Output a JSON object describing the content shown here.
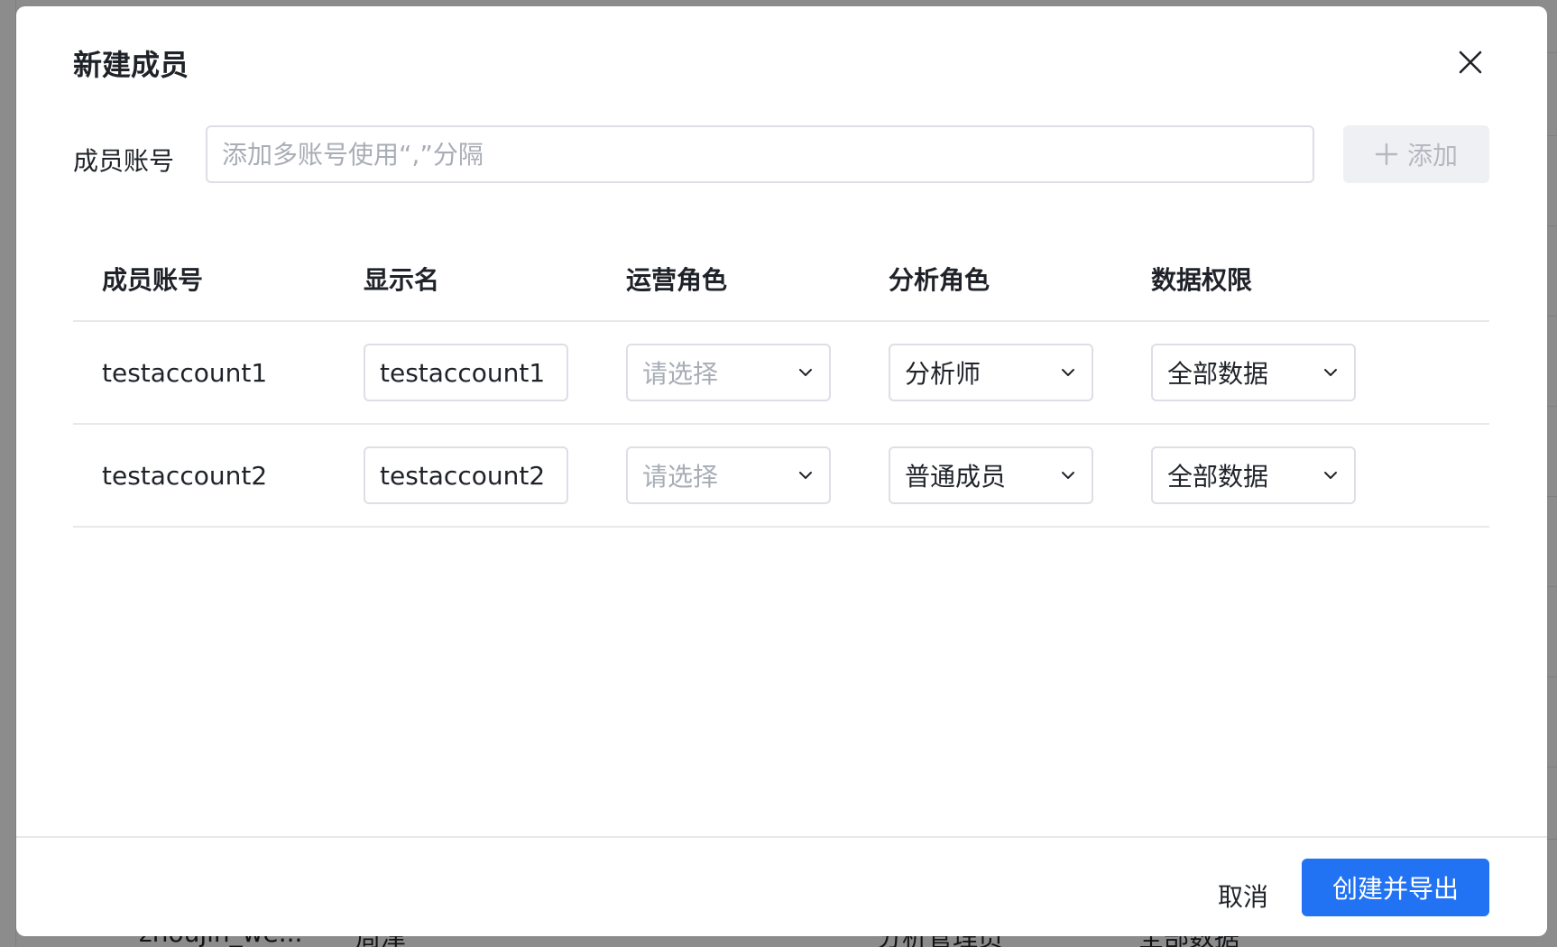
{
  "background": {
    "row": {
      "account": "zhoujin_we...",
      "display_name": "周津",
      "ops_role": "--",
      "analysis_role": "分析管理员",
      "data_permission": "全部数据",
      "extra": "--"
    }
  },
  "modal": {
    "title": "新建成员",
    "account_label": "成员账号",
    "account_placeholder": "添加多账号使用“,”分隔",
    "add_button": "添加",
    "table": {
      "headers": {
        "account": "成员账号",
        "display_name": "显示名",
        "ops_role": "运营角色",
        "analysis_role": "分析角色",
        "data_permission": "数据权限"
      },
      "rows": [
        {
          "account": "testaccount1",
          "display_name": "testaccount1",
          "ops_role": "请选择",
          "analysis_role": "分析师",
          "data_permission": "全部数据"
        },
        {
          "account": "testaccount2",
          "display_name": "testaccount2",
          "ops_role": "请选择",
          "analysis_role": "普通成员",
          "data_permission": "全部数据"
        }
      ]
    },
    "cancel_button": "取消",
    "submit_button": "创建并导出"
  },
  "colors": {
    "primary": "#2173f3",
    "text": "#1f2329",
    "placeholder": "#a8adb6",
    "border": "#dcdfe6",
    "divider": "#e6e8eb",
    "disabled_bg": "#eff0f3"
  },
  "icons": {
    "close": "close-icon",
    "add": "plus-icon",
    "dropdown": "chevron-down-icon"
  }
}
